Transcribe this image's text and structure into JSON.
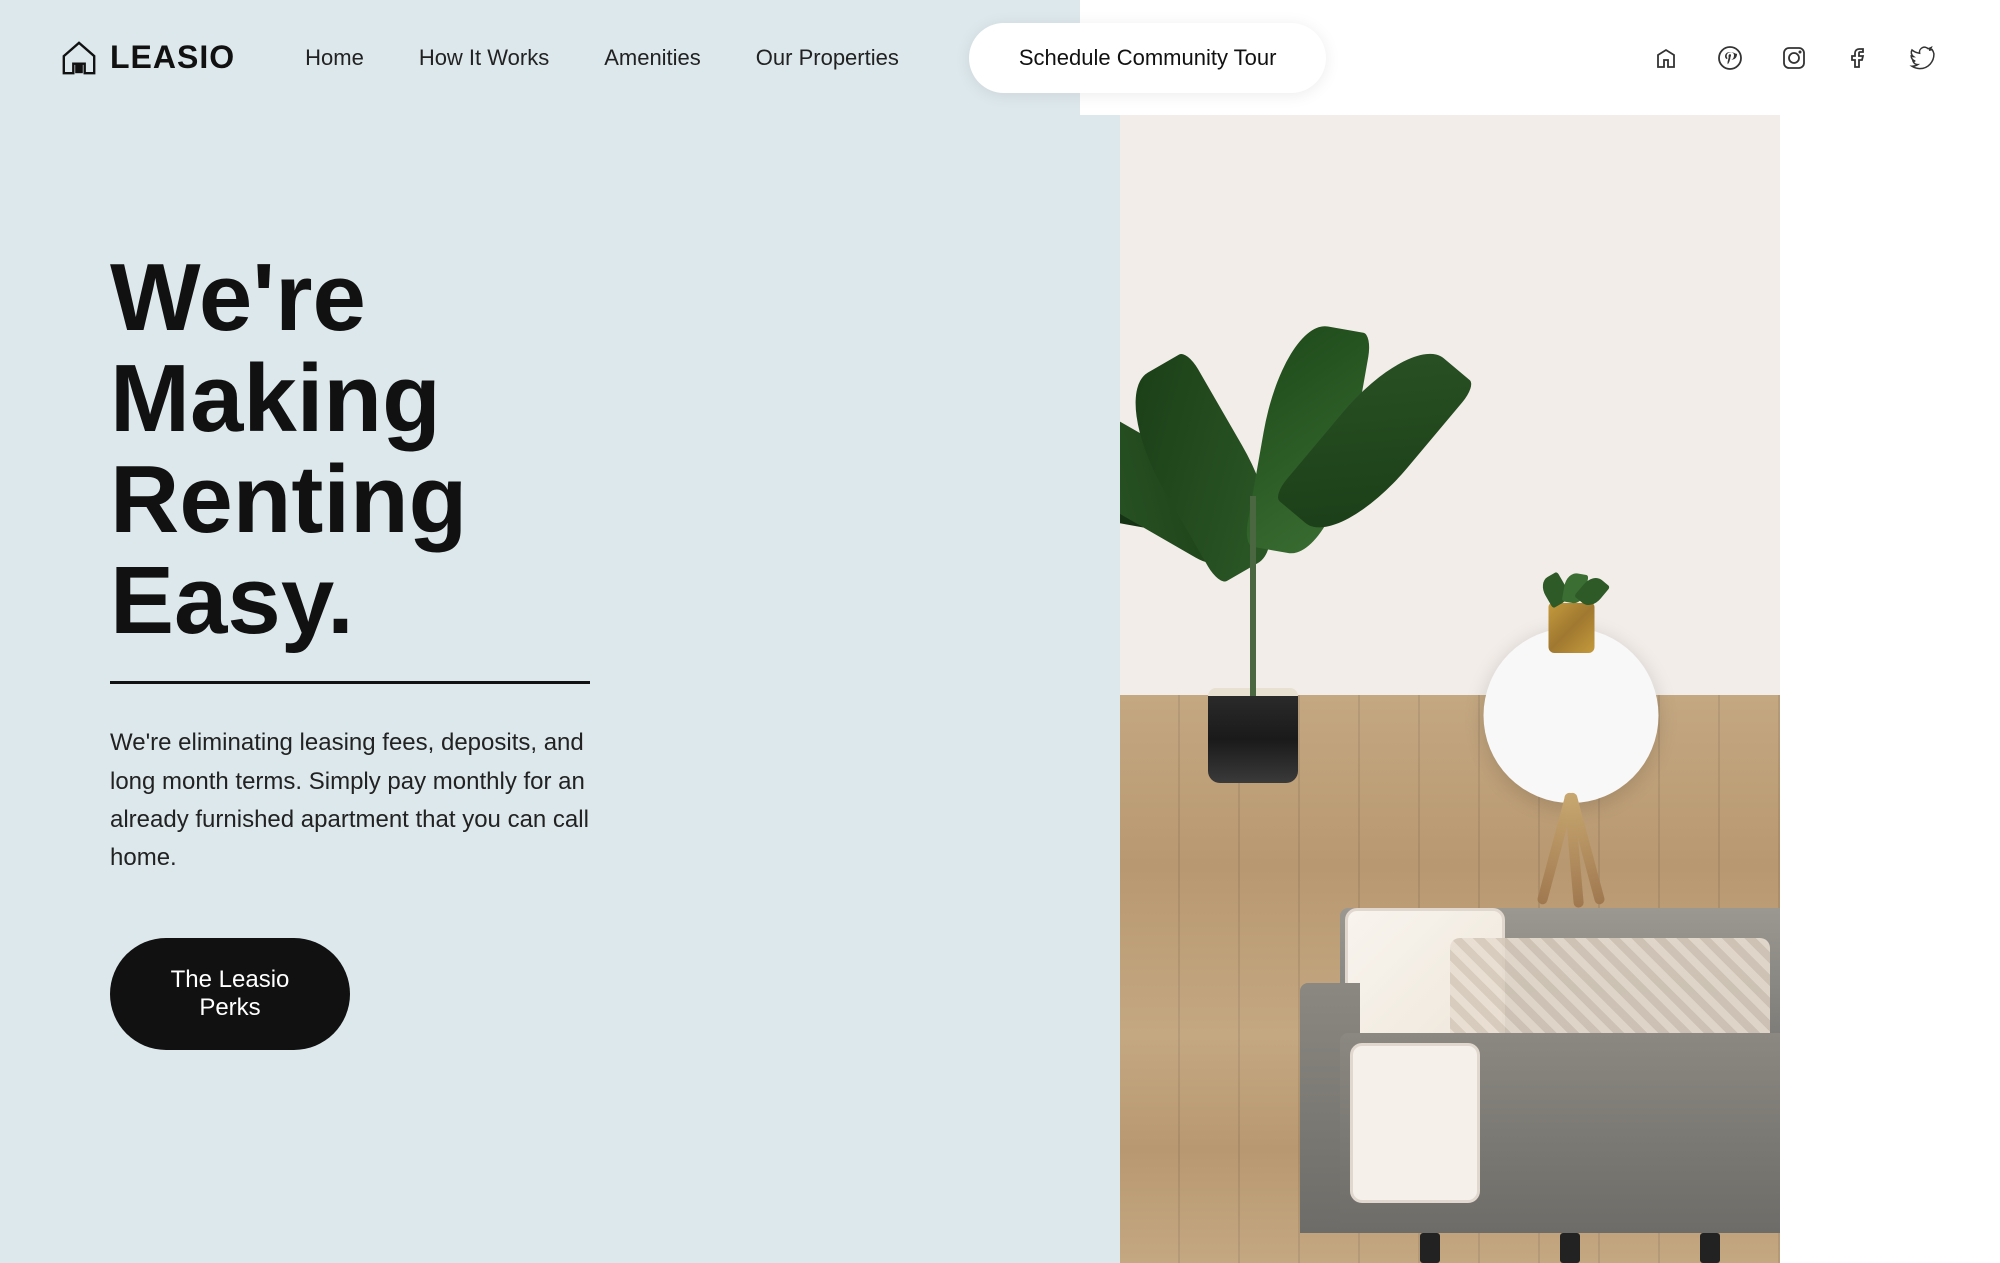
{
  "brand": {
    "name": "LEASIO",
    "logo_alt": "Leasio home icon"
  },
  "nav": {
    "links": [
      {
        "label": "Home",
        "href": "#"
      },
      {
        "label": "How It Works",
        "href": "#"
      },
      {
        "label": "Amenities",
        "href": "#"
      },
      {
        "label": "Our Properties",
        "href": "#"
      }
    ],
    "cta_label": "Schedule Community Tour"
  },
  "social_icons": [
    {
      "name": "houzz-icon",
      "symbol": "⌂"
    },
    {
      "name": "pinterest-icon",
      "symbol": "𝕻"
    },
    {
      "name": "instagram-icon",
      "symbol": "◻"
    },
    {
      "name": "facebook-icon",
      "symbol": "𝔽"
    },
    {
      "name": "twitter-icon",
      "symbol": "𝕋"
    }
  ],
  "hero": {
    "headline_line1": "We're Making",
    "headline_line2": "Renting Easy.",
    "subtitle": "We're eliminating leasing fees, deposits, and long month terms. Simply pay monthly for an already furnished apartment that you can call home.",
    "cta_label": "The Leasio Perks"
  },
  "colors": {
    "bg_light": "#dde8ec",
    "bg_white": "#ffffff",
    "text_dark": "#111111",
    "btn_dark": "#111111",
    "btn_text": "#ffffff"
  }
}
